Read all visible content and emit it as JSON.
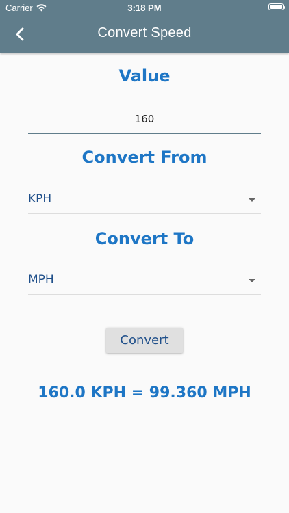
{
  "status_bar": {
    "carrier": "Carrier",
    "time": "3:18 PM"
  },
  "app_bar": {
    "title": "Convert Speed",
    "background": "#607d8b"
  },
  "form": {
    "value_label": "Value",
    "value": "160",
    "from_label": "Convert From",
    "from_unit": "KPH",
    "to_label": "Convert To",
    "to_unit": "MPH",
    "convert_button": "Convert"
  },
  "result": "160.0 KPH = 99.360 MPH",
  "colors": {
    "accent": "#1e76c5",
    "dropdown_text": "#1f4f8a",
    "background": "#fafafa"
  },
  "icons": {
    "back": "chevron-left-icon",
    "wifi": "wifi-icon",
    "battery": "battery-icon",
    "caret": "caret-down-icon"
  }
}
